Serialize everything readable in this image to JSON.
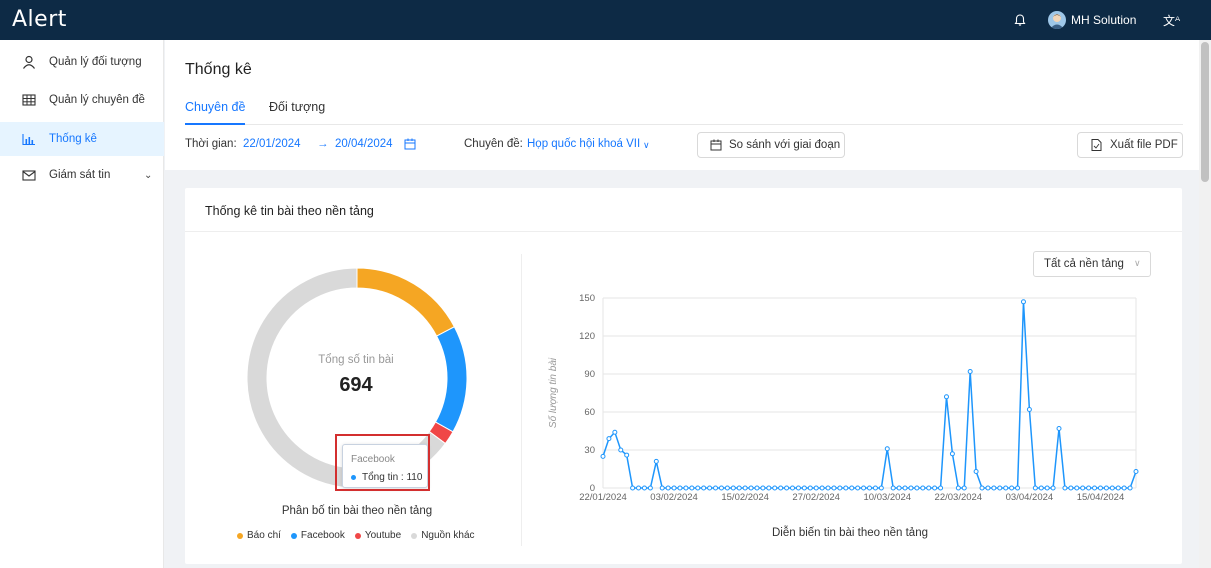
{
  "app": {
    "logo": "Alert"
  },
  "header": {
    "user_name": "MH Solution"
  },
  "sidebar": {
    "items": [
      {
        "label": "Quản lý đối tượng"
      },
      {
        "label": "Quản lý chuyên đề"
      },
      {
        "label": "Thống kê"
      },
      {
        "label": "Giám sát tin"
      }
    ]
  },
  "page": {
    "title": "Thống kê",
    "tabs": [
      {
        "label": "Chuyên đề"
      },
      {
        "label": "Đối tượng"
      }
    ]
  },
  "filters": {
    "time_label": "Thời gian:",
    "date_from": "22/01/2024",
    "date_to": "20/04/2024",
    "topic_label": "Chuyên đề:",
    "topic_value": "Họp quốc hội khoá VII",
    "compare_button": "So sánh với giai đoạn",
    "export_button": "Xuất file PDF"
  },
  "card": {
    "title": "Thống kê tin bài theo nền tảng",
    "platform_select": "Tất cả nền tảng"
  },
  "colors": {
    "bao_chi": "#f5a623",
    "facebook": "#1e96fc",
    "youtube": "#f04747",
    "nguon_khac": "#d9d9d9"
  },
  "chart_data": [
    {
      "type": "pie",
      "variant": "donut",
      "center_label": "Tổng số tin bài",
      "center_value": "694",
      "caption": "Phân bố tin bài theo nền tảng",
      "series": [
        {
          "name": "Báo chí",
          "value": 120
        },
        {
          "name": "Facebook",
          "value": 110
        },
        {
          "name": "Youtube",
          "value": 14
        },
        {
          "name": "Nguồn khác",
          "value": 450
        }
      ],
      "tooltip": {
        "name": "Facebook",
        "label": "Tổng tin",
        "value": "110"
      },
      "legend_position": "bottom"
    },
    {
      "type": "line",
      "ylabel": "Số lượng tin bài",
      "caption": "Diễn biến tin bài theo nền tảng",
      "ylim": [
        0,
        150
      ],
      "yticks": [
        "0",
        "30",
        "60",
        "90",
        "120",
        "150"
      ],
      "xticks": [
        "22/01/2024",
        "03/02/2024",
        "15/02/2024",
        "27/02/2024",
        "10/03/2024",
        "22/03/2024",
        "03/04/2024",
        "15/04/2024"
      ],
      "grid": true,
      "x_start": "22/01/2024",
      "x_end": "20/04/2024",
      "series": [
        {
          "values": [
            25,
            39,
            44,
            30,
            26,
            0,
            0,
            0,
            0,
            21,
            0,
            0,
            0,
            0,
            0,
            0,
            0,
            0,
            0,
            0,
            0,
            0,
            0,
            0,
            0,
            0,
            0,
            0,
            0,
            0,
            0,
            0,
            0,
            0,
            0,
            0,
            0,
            0,
            0,
            0,
            0,
            0,
            0,
            0,
            0,
            0,
            0,
            0,
            31,
            0,
            0,
            0,
            0,
            0,
            0,
            0,
            0,
            0,
            72,
            27,
            0,
            0,
            92,
            13,
            0,
            0,
            0,
            0,
            0,
            0,
            0,
            147,
            62,
            0,
            0,
            0,
            0,
            47,
            0,
            0,
            0,
            0,
            0,
            0,
            0,
            0,
            0,
            0,
            0,
            0,
            13
          ]
        }
      ]
    }
  ]
}
